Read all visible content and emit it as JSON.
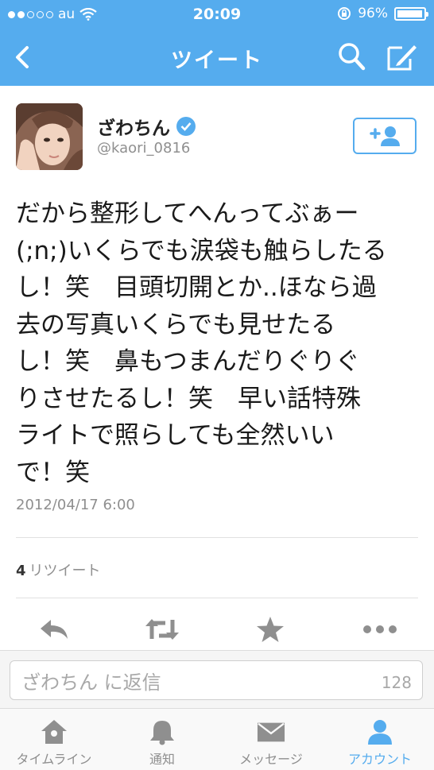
{
  "status_bar": {
    "carrier": "au",
    "time": "20:09",
    "battery": "96%",
    "battery_level": 0.96
  },
  "nav": {
    "title": "ツイート",
    "back_icon": "chevron-left-icon",
    "search_icon": "search-icon",
    "compose_icon": "compose-icon"
  },
  "tweet": {
    "user_name": "ざわちん",
    "handle": "@kaori_0816",
    "verified": true,
    "text_lines": [
      "だから整形してへんってぶぁー",
      "(;n;)いくらでも涙袋も触らしたる",
      "し！笑　目頭切開とか..ほなら過",
      "去の写真いくらでも見せたる",
      "し！笑　鼻もつまんだりぐりぐ",
      "りさせたるし！笑　早い話特殊",
      "ライトで照らしても全然いい",
      "で！笑"
    ],
    "timestamp": "2012/04/17 6:00",
    "retweet_count": "4",
    "retweet_label": "リツイート"
  },
  "reply": {
    "placeholder": "ざわちん に返信",
    "char_count": "128"
  },
  "tabs": [
    {
      "label": "タイムライン",
      "icon": "home-icon",
      "active": false
    },
    {
      "label": "通知",
      "icon": "bell-icon",
      "active": false
    },
    {
      "label": "メッセージ",
      "icon": "envelope-icon",
      "active": false
    },
    {
      "label": "アカウント",
      "icon": "person-icon",
      "active": true
    }
  ],
  "colors": {
    "brand_blue": "#55acee",
    "icon_gray": "#8f8f8f"
  }
}
